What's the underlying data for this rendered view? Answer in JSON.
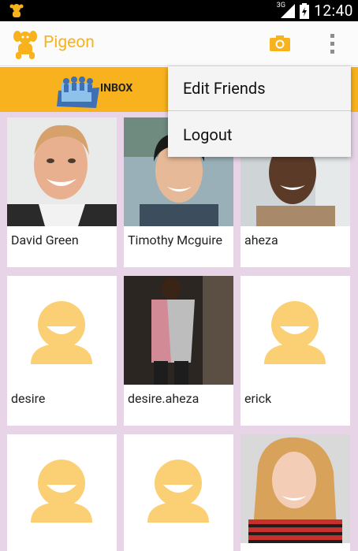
{
  "status_bar": {
    "network": "3G",
    "time": "12:40"
  },
  "action_bar": {
    "title": "Pigeon",
    "brand_color": "#f8b21d"
  },
  "tabs": [
    {
      "label": "INBOX"
    }
  ],
  "menu": {
    "items": [
      {
        "label": "Edit Friends"
      },
      {
        "label": "Logout"
      }
    ]
  },
  "friends": [
    {
      "name": "David Green",
      "avatar": "photo"
    },
    {
      "name": "Timothy Mcguire",
      "avatar": "photo"
    },
    {
      "name": "aheza",
      "avatar": "photo"
    },
    {
      "name": "desire",
      "avatar": "placeholder"
    },
    {
      "name": "desire.aheza",
      "avatar": "photo"
    },
    {
      "name": "erick",
      "avatar": "placeholder"
    },
    {
      "name": "",
      "avatar": "placeholder"
    },
    {
      "name": "",
      "avatar": "placeholder"
    },
    {
      "name": "",
      "avatar": "photo"
    }
  ]
}
